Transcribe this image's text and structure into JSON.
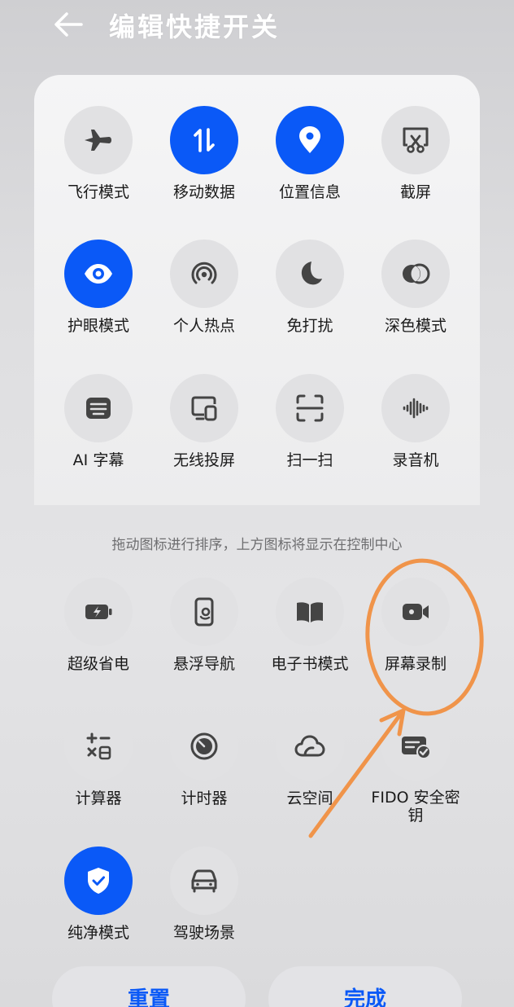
{
  "header": {
    "title": "编辑快捷开关",
    "back_icon": "arrow-left-icon"
  },
  "active_tiles": [
    {
      "label": "飞行模式",
      "icon": "airplane-icon",
      "on": false
    },
    {
      "label": "移动数据",
      "icon": "mobile-data-icon",
      "on": true
    },
    {
      "label": "位置信息",
      "icon": "location-pin-icon",
      "on": true
    },
    {
      "label": "截屏",
      "icon": "screenshot-scissors-icon",
      "on": false
    },
    {
      "label": "护眼模式",
      "icon": "eye-icon",
      "on": true
    },
    {
      "label": "个人热点",
      "icon": "hotspot-icon",
      "on": false
    },
    {
      "label": "免打扰",
      "icon": "moon-icon",
      "on": false
    },
    {
      "label": "深色模式",
      "icon": "dark-mode-icon",
      "on": false
    },
    {
      "label": "AI 字幕",
      "icon": "subtitle-icon",
      "on": false
    },
    {
      "label": "无线投屏",
      "icon": "wireless-projection-icon",
      "on": false
    },
    {
      "label": "扫一扫",
      "icon": "scan-icon",
      "on": false
    },
    {
      "label": "录音机",
      "icon": "voice-recorder-icon",
      "on": false
    }
  ],
  "hint": "拖动图标进行排序，上方图标将显示在控制中心",
  "inactive_tiles": [
    {
      "label": "超级省电",
      "icon": "battery-saver-icon",
      "on": false
    },
    {
      "label": "悬浮导航",
      "icon": "floating-nav-icon",
      "on": false
    },
    {
      "label": "电子书模式",
      "icon": "book-icon",
      "on": false
    },
    {
      "label": "屏幕录制",
      "icon": "video-camera-icon",
      "on": false
    },
    {
      "label": "计算器",
      "icon": "calculator-icon",
      "on": false
    },
    {
      "label": "计时器",
      "icon": "timer-icon",
      "on": false
    },
    {
      "label": "云空间",
      "icon": "cloud-icon",
      "on": false
    },
    {
      "label": "FIDO 安全密钥",
      "icon": "security-key-icon",
      "on": false
    },
    {
      "label": "纯净模式",
      "icon": "shield-check-icon",
      "on": true
    },
    {
      "label": "驾驶场景",
      "icon": "car-icon",
      "on": false
    }
  ],
  "buttons": {
    "reset": "重置",
    "done": "完成"
  },
  "colors": {
    "accent": "#0a59f7",
    "tile_off": "#e1e1e3",
    "annotation": "#f0944a"
  }
}
